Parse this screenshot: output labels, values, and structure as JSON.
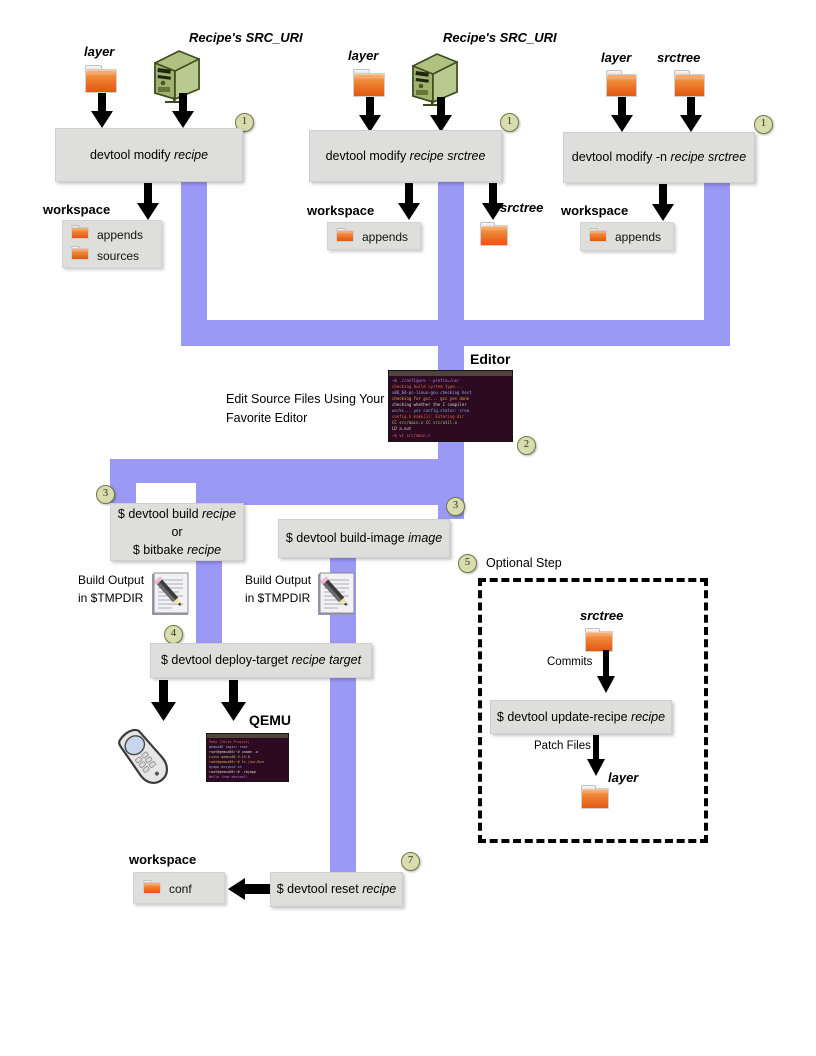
{
  "diagram": {
    "title": "devtool workflow",
    "colors": {
      "flow": "#9a99f5",
      "box": "#dededd",
      "folder": "#e8651c",
      "server": "#a9bd73",
      "terminal": "#2b0a22",
      "step_circle": "#d9dcae"
    }
  },
  "columns": [
    {
      "id": "col-1",
      "step": "1",
      "inputs": [
        {
          "type": "folder-icon",
          "label": "layer"
        },
        {
          "type": "server-icon",
          "label": "Recipe's SRC_URI"
        }
      ],
      "command": {
        "text": "devtool modify recipe",
        "plain": "devtool modify ",
        "italic": "recipe"
      },
      "workspace_label": "workspace",
      "workspace_items": [
        "appends",
        "sources"
      ]
    },
    {
      "id": "col-2",
      "step": "1",
      "inputs": [
        {
          "type": "folder-icon",
          "label": "layer"
        },
        {
          "type": "server-icon",
          "label": "Recipe's SRC_URI"
        }
      ],
      "command": {
        "text": "devtool modify recipe srctree",
        "plain": "devtool modify ",
        "italic": "recipe srctree"
      },
      "workspace_label": "workspace",
      "workspace_items": [
        "appends"
      ],
      "side_output": {
        "label": "srctree",
        "type": "folder-icon"
      }
    },
    {
      "id": "col-3",
      "step": "1",
      "inputs": [
        {
          "type": "folder-icon",
          "label": "layer"
        },
        {
          "type": "folder-icon",
          "label": "srctree"
        }
      ],
      "command": {
        "text": "devtool modify -n recipe srctree",
        "plain": "devtool modify -n ",
        "italic": "recipe srctree"
      },
      "workspace_label": "workspace",
      "workspace_items": [
        "appends"
      ]
    }
  ],
  "editor": {
    "step": "2",
    "title": "Editor",
    "caption_line1": "Edit Source Files Using Your",
    "caption_line2": "Favorite Editor"
  },
  "build": {
    "left": {
      "step": "3",
      "line1_plain": "$ devtool build ",
      "line1_italic": "recipe",
      "line2": "or",
      "line3_plain": "$ bitbake ",
      "line3_italic": "recipe",
      "output_line1": "Build Output",
      "output_line2": "in $TMPDIR"
    },
    "right": {
      "step": "3",
      "plain": "$ devtool build-image ",
      "italic": "image",
      "output_line1": "Build Output",
      "output_line2": "in $TMPDIR"
    }
  },
  "deploy": {
    "step": "4",
    "plain": "$ devtool deploy-target ",
    "italic": "recipe target",
    "targets": [
      {
        "type": "phone-icon",
        "label": ""
      },
      {
        "type": "qemu-terminal",
        "label": "QEMU"
      }
    ]
  },
  "optional": {
    "step": "5",
    "label": "Optional Step",
    "srctree_label": "srctree",
    "commits_label": "Commits",
    "command_plain": "$ devtool update-recipe ",
    "command_italic": "recipe",
    "patch_label": "Patch Files",
    "layer_label": "layer"
  },
  "reset": {
    "step": "7",
    "plain": "$ devtool reset ",
    "italic": "recipe",
    "workspace_label": "workspace",
    "workspace_items": [
      "conf"
    ]
  }
}
